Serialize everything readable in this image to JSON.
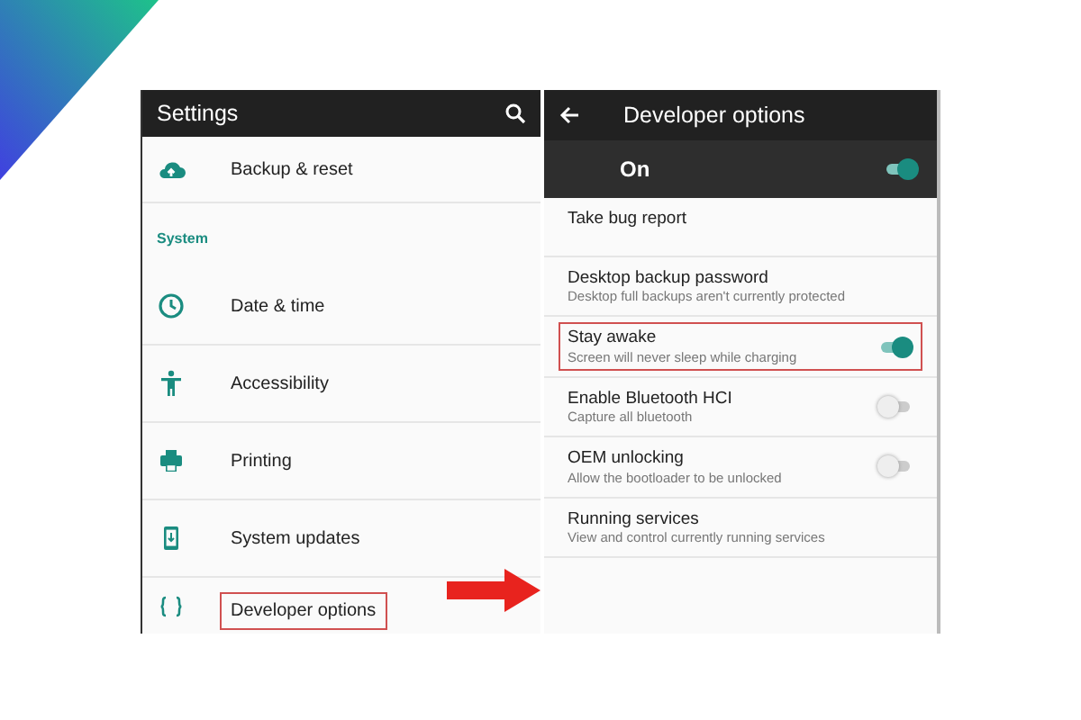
{
  "settings": {
    "title": "Settings",
    "search": true,
    "items": [
      {
        "kind": "item",
        "label": "Backup & reset",
        "highlighted": false
      },
      {
        "kind": "header",
        "label": "System"
      },
      {
        "kind": "item",
        "label": "Date & time",
        "highlighted": false
      },
      {
        "kind": "item",
        "label": "Accessibility",
        "highlighted": false
      },
      {
        "kind": "item",
        "label": "Printing",
        "highlighted": false
      },
      {
        "kind": "item",
        "label": "System updates",
        "highlighted": false
      },
      {
        "kind": "item",
        "label": "Developer options",
        "highlighted": true
      }
    ]
  },
  "developer_options": {
    "title": "Developer options",
    "master": {
      "label": "On",
      "on": true
    },
    "options": [
      {
        "kind": "plain",
        "title": "Take bug report",
        "highlighted": false
      },
      {
        "kind": "plain",
        "title": "Desktop backup password",
        "summary": "Desktop full backups aren't currently protected",
        "highlighted": false
      },
      {
        "kind": "switch",
        "title": "Stay awake",
        "summary": "Screen will never sleep while charging",
        "on": true,
        "highlighted": true
      },
      {
        "kind": "switch",
        "title": "Enable Bluetooth HCI",
        "summary": "Capture all bluetooth",
        "on": false,
        "highlighted": false
      },
      {
        "kind": "switch",
        "title": "OEM unlocking",
        "summary": "Allow the bootloader to be unlocked",
        "on": false,
        "highlighted": false
      },
      {
        "kind": "plain",
        "title": "Running services",
        "summary": "View and control currently running services",
        "highlighted": false
      }
    ]
  }
}
